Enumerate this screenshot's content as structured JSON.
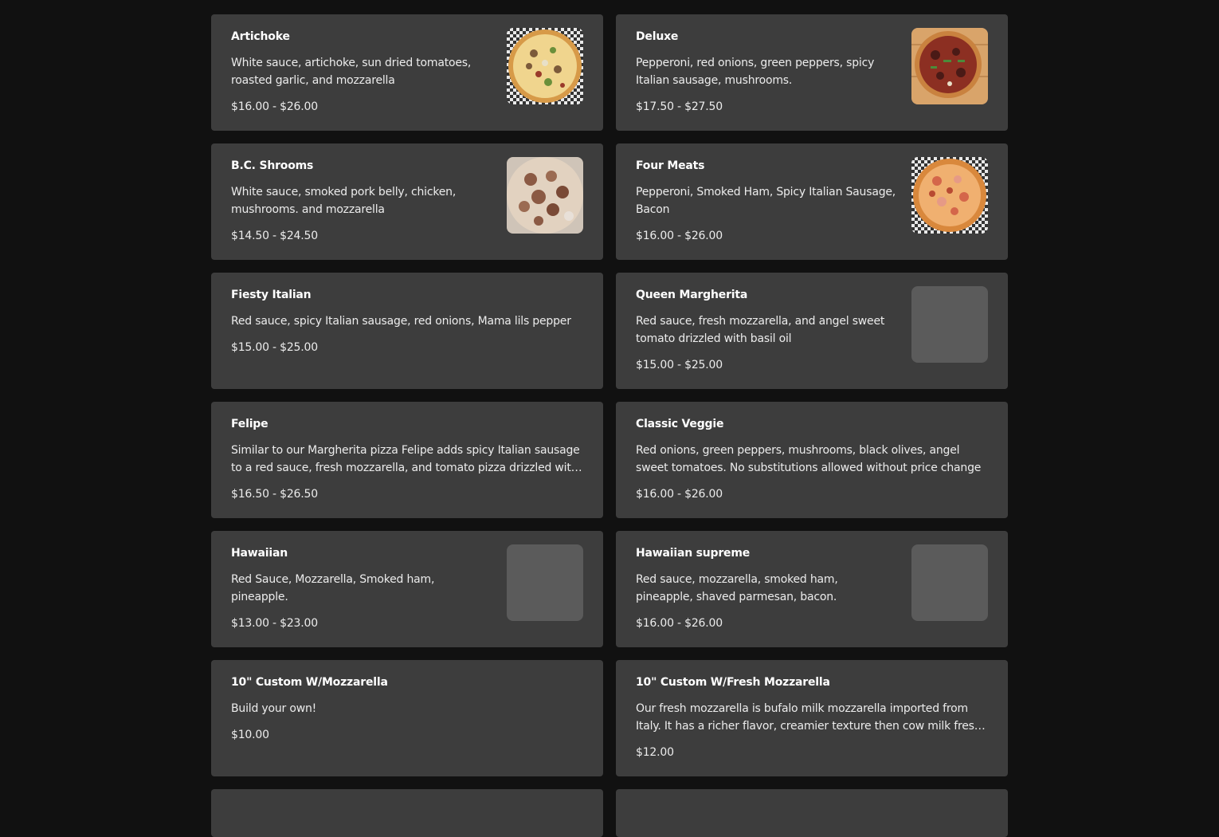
{
  "menu": {
    "items": [
      {
        "name": "Artichoke",
        "description": "White sauce, artichoke, sun dried tomatoes, roasted garlic, and mozzarella",
        "price": "$16.00 - $26.00",
        "image": "artichoke-pizza-photo"
      },
      {
        "name": "Deluxe",
        "description": "Pepperoni, red onions, green peppers, spicy Italian sausage, mushrooms.",
        "price": "$17.50 - $27.50",
        "image": "deluxe-pizza-photo"
      },
      {
        "name": "B.C. Shrooms",
        "description": "White sauce, smoked pork belly, chicken, mushrooms. and mozzarella",
        "price": "$14.50 - $24.50",
        "image": "bc-shrooms-pizza-photo"
      },
      {
        "name": "Four Meats",
        "description": "Pepperoni, Smoked Ham, Spicy Italian Sausage, Bacon",
        "price": "$16.00 - $26.00",
        "image": "four-meats-pizza-photo"
      },
      {
        "name": "Fiesty Italian",
        "description": "Red sauce, spicy Italian sausage, red onions, Mama lils pepper",
        "price": "$15.00 - $25.00",
        "image": null
      },
      {
        "name": "Queen Margherita",
        "description": "Red sauce, fresh mozzarella, and angel sweet tomato drizzled with basil oil",
        "price": "$15.00 - $25.00",
        "image": "placeholder"
      },
      {
        "name": "Felipe",
        "description": "Similar to our Margherita pizza Felipe adds spicy Italian sausage to a red sauce, fresh mozzarella, and tomato pizza drizzled with basil oil",
        "price": "$16.50 - $26.50",
        "image": null
      },
      {
        "name": "Classic Veggie",
        "description": "Red onions, green peppers, mushrooms, black olives, angel sweet tomatoes. No substitutions allowed without price change",
        "price": "$16.00 - $26.00",
        "image": null
      },
      {
        "name": "Hawaiian",
        "description": "Red Sauce, Mozzarella, Smoked ham, pineapple.",
        "price": "$13.00 - $23.00",
        "image": "placeholder"
      },
      {
        "name": "Hawaiian supreme",
        "description": "Red sauce, mozzarella, smoked ham, pineapple, shaved parmesan, bacon.",
        "price": "$16.00 - $26.00",
        "image": "placeholder"
      },
      {
        "name": "10\" Custom W/Mozzarella",
        "description": "Build your own!",
        "price": "$10.00",
        "image": null
      },
      {
        "name": "10\" Custom W/Fresh Mozzarella",
        "description": "Our fresh mozzarella is bufalo milk mozzarella imported from Italy. It has a richer flavor, creamier texture then cow milk fresh mozzarella.",
        "price": "$12.00",
        "image": null
      }
    ]
  },
  "colors": {
    "page_background": "#111111",
    "card_background": "#3d3d3d",
    "placeholder": "#5b5b5b",
    "text": "#ffffff"
  }
}
